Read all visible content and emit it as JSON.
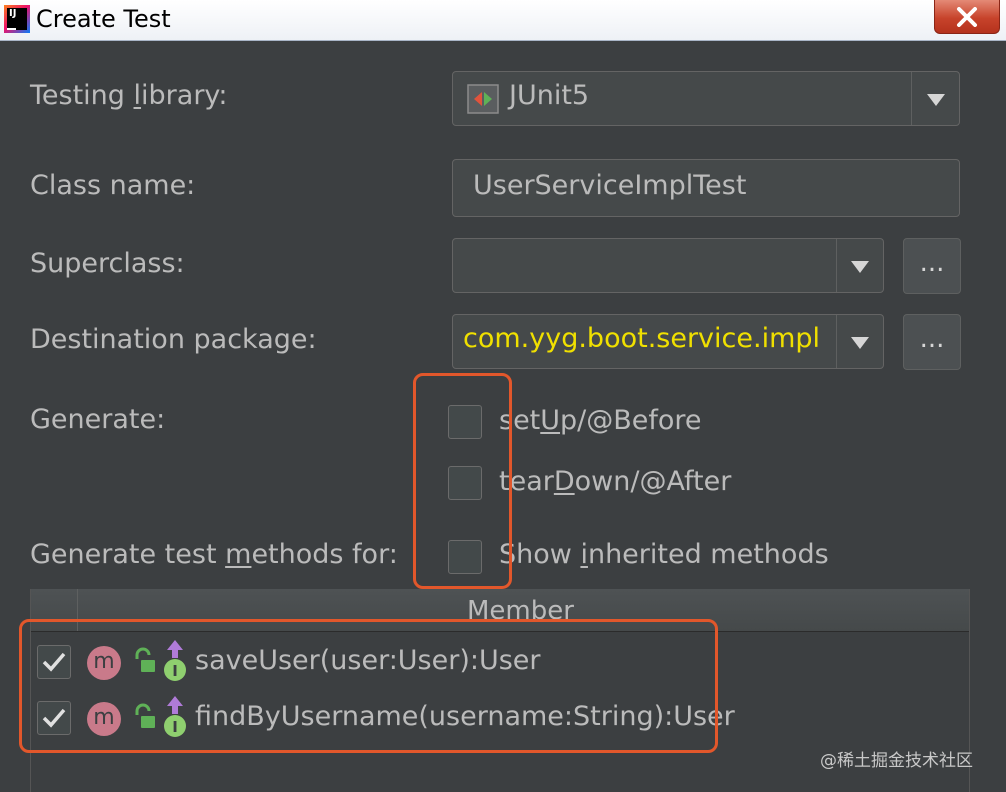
{
  "window": {
    "title": "Create Test",
    "app_icon_text": "IJ"
  },
  "form": {
    "testing_library": {
      "label_pre": "Testing ",
      "label_u": "l",
      "label_post": "ibrary:",
      "value": "JUnit5"
    },
    "class_name": {
      "label": "Class name:",
      "value": "UserServiceImplTest"
    },
    "superclass": {
      "label": "Superclass:",
      "value": "",
      "browse": "..."
    },
    "destination_package": {
      "label": "Destination package:",
      "value": "com.yyg.boot.service.impl",
      "browse": "..."
    },
    "generate": {
      "label": "Generate:",
      "options": [
        {
          "pre": "set",
          "u": "U",
          "post": "p/@Before",
          "checked": false
        },
        {
          "pre": "tear",
          "u": "D",
          "post": "own/@After",
          "checked": false
        }
      ]
    },
    "methods_for": {
      "label_pre": "Generate test ",
      "label_u": "m",
      "label_post": "ethods for:",
      "inherited": {
        "pre": "Show ",
        "u": "i",
        "post": "nherited methods",
        "checked": false
      }
    }
  },
  "table": {
    "header": "Member",
    "rows": [
      {
        "checked": true,
        "icon_letter": "m",
        "text": "saveUser(user:User):User"
      },
      {
        "checked": true,
        "icon_letter": "m",
        "text": "findByUsername(username:String):User"
      }
    ]
  },
  "watermark": "@稀土掘金技术社区",
  "colors": {
    "background": "#3c3f41",
    "highlight": "#e2572b",
    "package_text": "#f0e000"
  },
  "icons": [
    "close-icon",
    "junit-icon",
    "dropdown-arrow-icon",
    "method-icon",
    "lock-icon",
    "implements-icon",
    "check-icon"
  ]
}
